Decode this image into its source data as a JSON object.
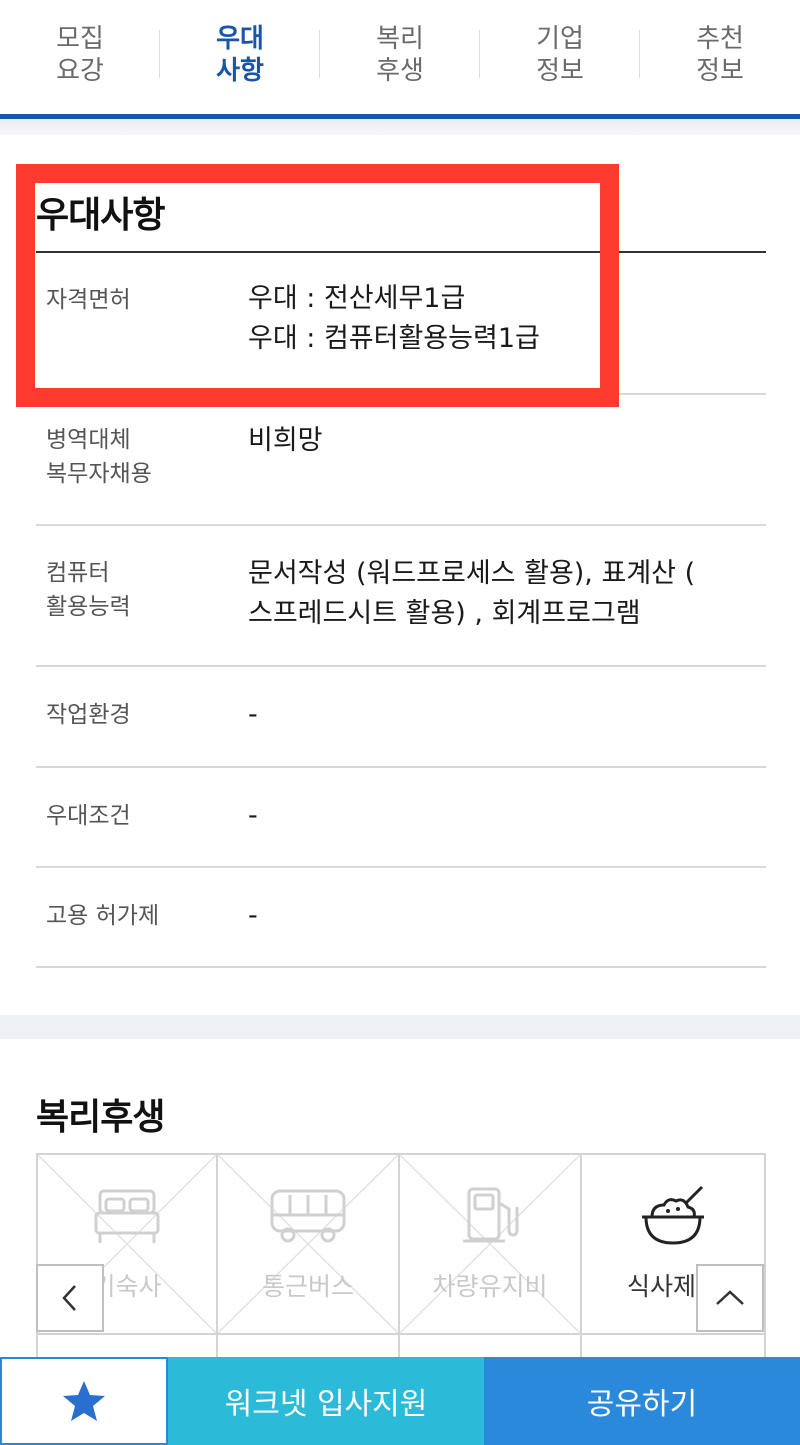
{
  "tabs": [
    {
      "label": "모집\n요강",
      "active": false
    },
    {
      "label": "우대\n사항",
      "active": true
    },
    {
      "label": "복리\n후생",
      "active": false
    },
    {
      "label": "기업\n정보",
      "active": false
    },
    {
      "label": "추천\n정보",
      "active": false
    }
  ],
  "preferential": {
    "title": "우대사항",
    "rows": [
      {
        "label": "자격면허",
        "values": [
          "우대 : 전산세무1급",
          "우대 : 컴퓨터활용능력1급"
        ]
      },
      {
        "label": "병역대체\n복무자채용",
        "values": [
          "비희망"
        ]
      },
      {
        "label": "컴퓨터\n활용능력",
        "values": [
          "문서작성 (워드프로세스 활용), 표계산 (",
          "스프레드시트 활용) , 회계프로그램"
        ]
      },
      {
        "label": "작업환경",
        "values": [
          "-"
        ]
      },
      {
        "label": "우대조건",
        "values": [
          "-"
        ]
      },
      {
        "label": "고용 허가제",
        "values": [
          "-"
        ]
      }
    ]
  },
  "welfare": {
    "title": "복리후생",
    "items": [
      {
        "label": "기숙사",
        "icon": "bed-icon",
        "enabled": false
      },
      {
        "label": "통근버스",
        "icon": "bus-icon",
        "enabled": false
      },
      {
        "label": "차량유지비",
        "icon": "fuel-pump-icon",
        "enabled": false
      },
      {
        "label": "식사제공",
        "icon": "rice-bowl-icon",
        "enabled": true
      }
    ]
  },
  "bottom_bar": {
    "apply_label": "워크넷 입사지원",
    "share_label": "공유하기"
  },
  "colors": {
    "accent": "#1a55a8",
    "highlight": "#ff3b30",
    "apply": "#2bbbd8",
    "share": "#2a89da"
  }
}
